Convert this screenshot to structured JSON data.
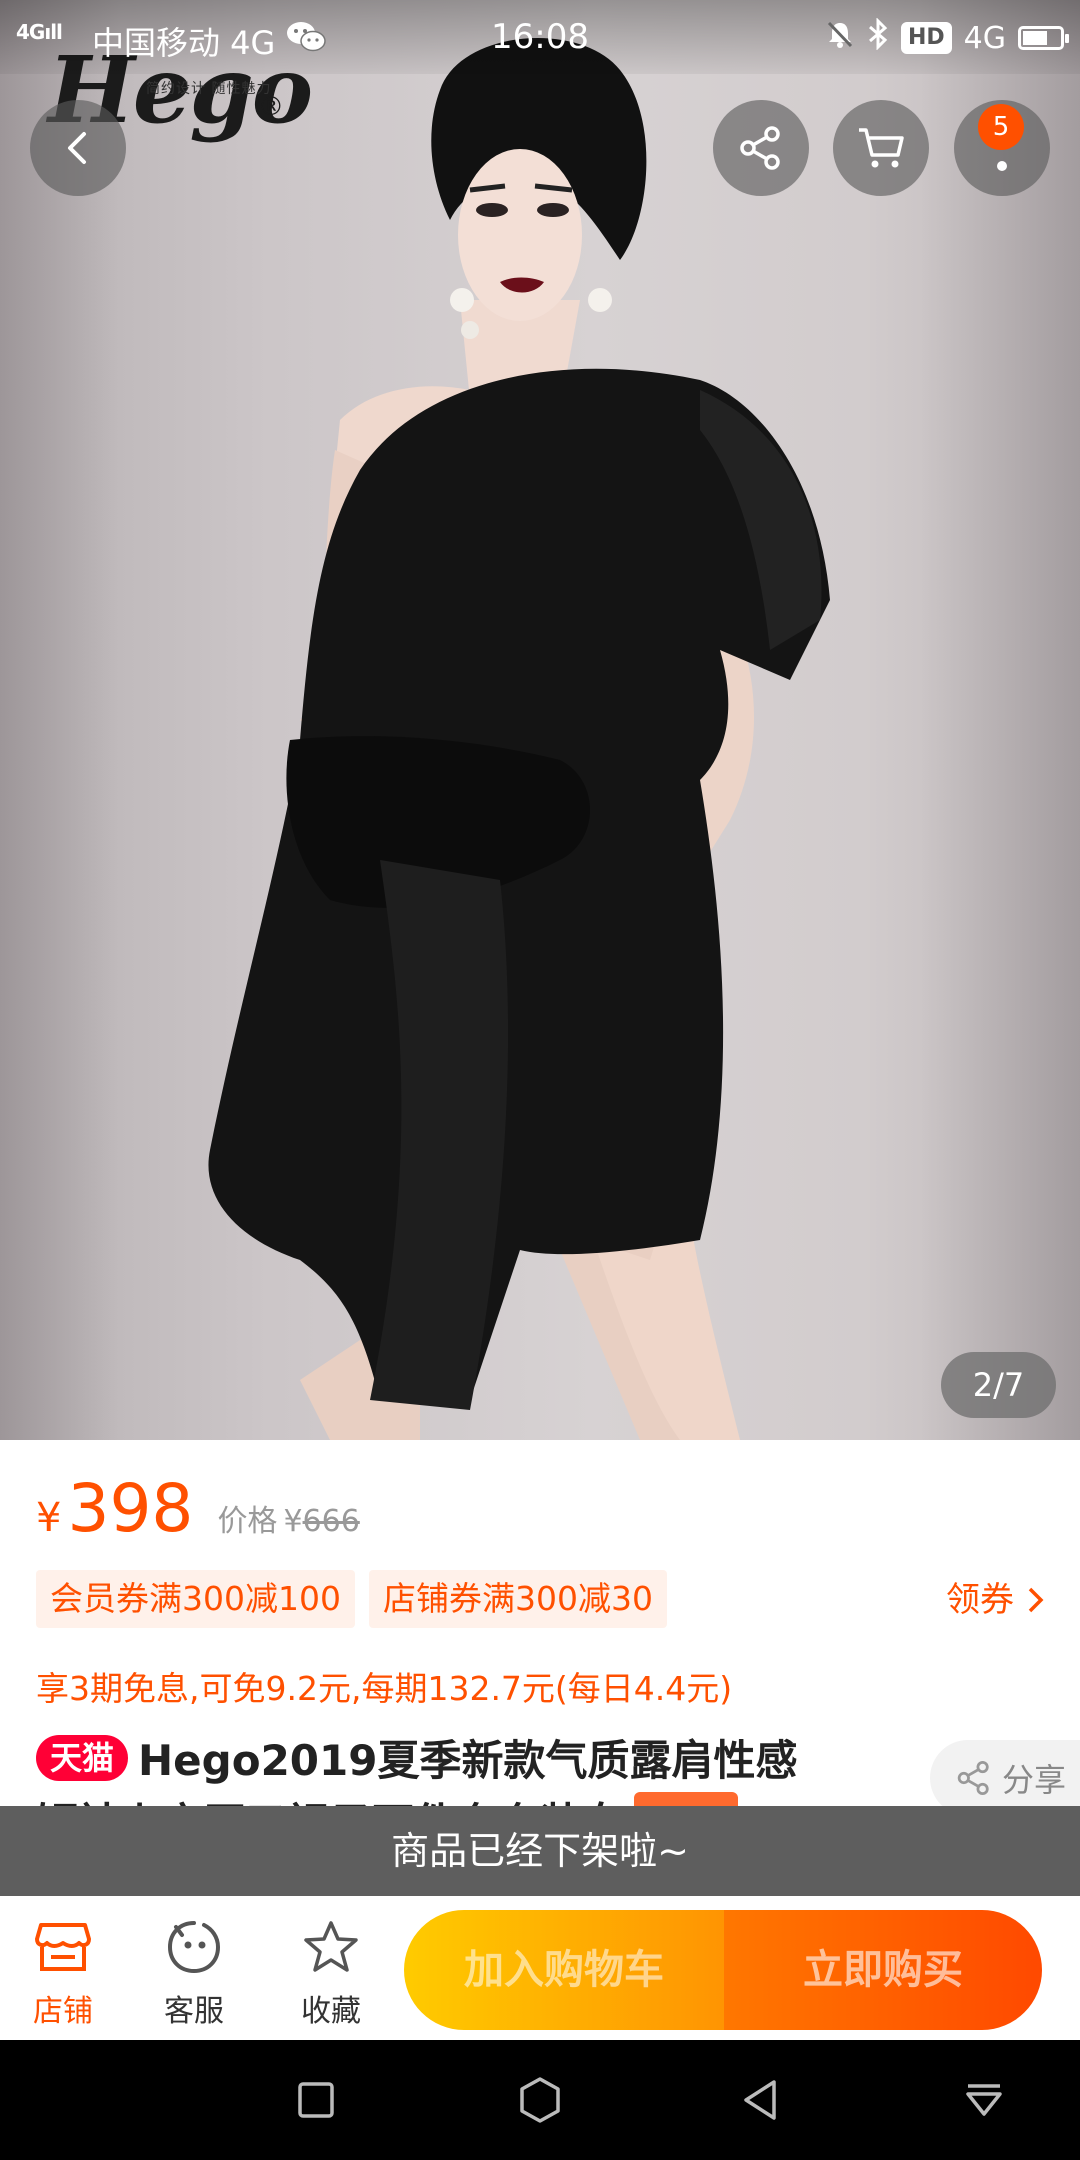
{
  "status_bar": {
    "signal": "4G",
    "carrier": "中国移动 4G",
    "time": "16:08",
    "hd": "HD",
    "network": "4G"
  },
  "hero": {
    "brand_logo": "Hego",
    "brand_tagline": "简约设计 随性魅力",
    "message_badge": "5",
    "image_counter": "2/7"
  },
  "price": {
    "currency": "¥",
    "current": "398",
    "original_label": "价格",
    "original_currency": "¥",
    "original": "666"
  },
  "coupons": {
    "items": [
      "会员券满300减100",
      "店铺券满300减30"
    ],
    "get_label": "领券"
  },
  "installment": "享3期免息,可免9.2元,每期132.7元(每日4.4元)",
  "product": {
    "platform_tag": "天猫",
    "title_line1": "Hego2019夏季新款气质露肩性感",
    "title_line2": "短袖上衣开叉裙子两件套套装女",
    "presale_tag": "加价购",
    "share_label": "分享"
  },
  "offline_banner": "商品已经下架啦~",
  "action_bar": {
    "store_label": "店铺",
    "service_label": "客服",
    "favorite_label": "收藏",
    "add_to_cart": "加入购物车",
    "buy_now": "立即购买"
  },
  "colors": {
    "accent": "#ff5000",
    "tmall_red": "#ff0036",
    "cart_yellow": "#ffcb00",
    "buy_orange": "#ff4900"
  }
}
